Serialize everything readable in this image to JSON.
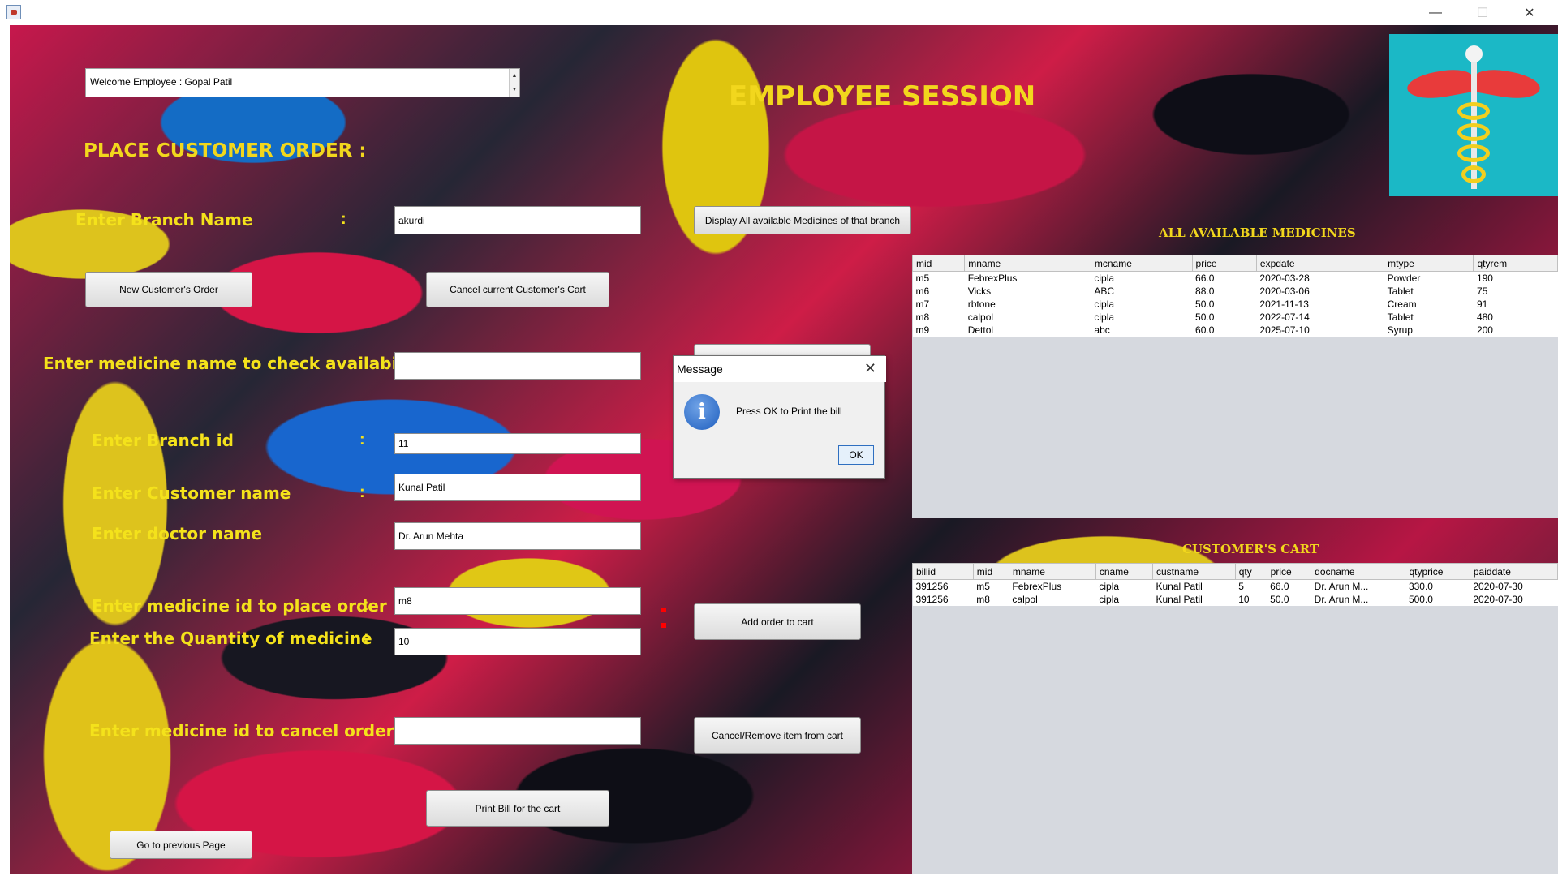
{
  "window": {
    "minimize": "—",
    "maximize": "☐",
    "close": "✕"
  },
  "welcome": "Welcome Employee : Gopal Patil",
  "headings": {
    "session": "EMPLOYEE SESSION",
    "place_order": "PLACE CUSTOMER ORDER   :",
    "available": "ALL AVAILABLE MEDICINES",
    "cart": "CUSTOMER'S CART"
  },
  "form": {
    "branch_name_label": "Enter Branch Name",
    "branch_name_value": "akurdi",
    "check_med_label": "Enter medicine name to check availability:",
    "check_med_value": "",
    "branch_id_label": "Enter Branch id",
    "branch_id_value": "11",
    "customer_label": "Enter Customer name",
    "customer_value": "Kunal Patil",
    "doctor_label": "Enter doctor name",
    "doctor_value": "Dr. Arun Mehta",
    "med_id_label": "Enter medicine id to place order",
    "med_id_value": "m8",
    "qty_label": "Enter the Quantity of medicine",
    "qty_value": "10",
    "cancel_id_label": "Enter medicine id to cancel order :",
    "cancel_id_value": "",
    "colon": ":"
  },
  "buttons": {
    "display_all": "Display All available Medicines of that branch",
    "new_order": "New Customer's Order",
    "cancel_cart": "Cancel current Customer's Cart",
    "add_order": "Add order to cart",
    "cancel_item": "Cancel/Remove item from cart",
    "print_bill": "Print Bill for the cart",
    "go_previous": "Go to previous Page"
  },
  "medicines": {
    "columns": [
      "mid",
      "mname",
      "mcname",
      "price",
      "expdate",
      "mtype",
      "qtyrem"
    ],
    "rows": [
      [
        "m5",
        "FebrexPlus",
        "cipla",
        "66.0",
        "2020-03-28",
        "Powder",
        "190"
      ],
      [
        "m6",
        "Vicks",
        "ABC",
        "88.0",
        "2020-03-06",
        "Tablet",
        "75"
      ],
      [
        "m7",
        "rbtone",
        "cipla",
        "50.0",
        "2021-11-13",
        "Cream",
        "91"
      ],
      [
        "m8",
        "calpol",
        "cipla",
        "50.0",
        "2022-07-14",
        "Tablet",
        "480"
      ],
      [
        "m9",
        "Dettol",
        "abc",
        "60.0",
        "2025-07-10",
        "Syrup",
        "200"
      ]
    ]
  },
  "cart": {
    "columns": [
      "billid",
      "mid",
      "mname",
      "cname",
      "custname",
      "qty",
      "price",
      "docname",
      "qtyprice",
      "paiddate"
    ],
    "rows": [
      [
        "391256",
        "m5",
        "FebrexPlus",
        "cipla",
        "Kunal Patil",
        "5",
        "66.0",
        "Dr. Arun M...",
        "330.0",
        "2020-07-30"
      ],
      [
        "391256",
        "m8",
        "calpol",
        "cipla",
        "Kunal Patil",
        "10",
        "50.0",
        "Dr. Arun M...",
        "500.0",
        "2020-07-30"
      ]
    ]
  },
  "dialog": {
    "title": "Message",
    "message": "Press OK to Print the bill",
    "ok": "OK",
    "icon": "i"
  }
}
